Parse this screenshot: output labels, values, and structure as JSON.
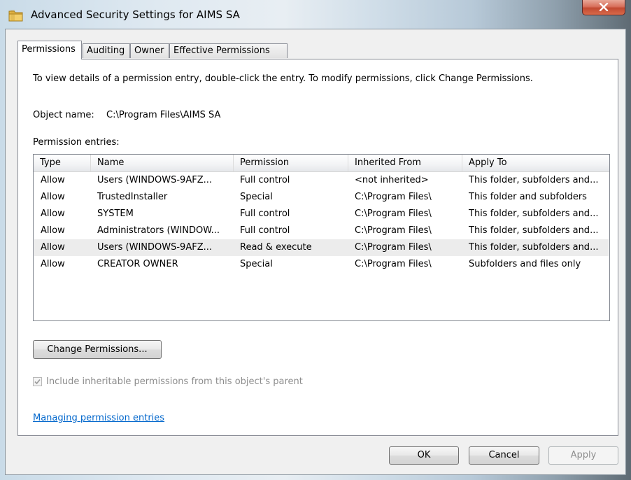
{
  "window": {
    "title": "Advanced Security Settings for AIMS SA"
  },
  "tabs": [
    {
      "label": "Permissions",
      "active": true
    },
    {
      "label": "Auditing",
      "active": false
    },
    {
      "label": "Owner",
      "active": false
    },
    {
      "label": "Effective Permissions",
      "active": false
    }
  ],
  "panel": {
    "instruction": "To view details of a permission entry, double-click the entry. To modify permissions, click Change Permissions.",
    "object_name_label": "Object name:",
    "object_name_value": "C:\\Program Files\\AIMS SA",
    "entries_label": "Permission entries:"
  },
  "table": {
    "columns": [
      "Type",
      "Name",
      "Permission",
      "Inherited From",
      "Apply To"
    ],
    "rows": [
      {
        "type": "Allow",
        "name": "Users (WINDOWS-9AFZ...",
        "permission": "Full control",
        "inherited_from": "<not inherited>",
        "apply_to": "This folder, subfolders and...",
        "selected": false
      },
      {
        "type": "Allow",
        "name": "TrustedInstaller",
        "permission": "Special",
        "inherited_from": "C:\\Program Files\\",
        "apply_to": "This folder and subfolders",
        "selected": false
      },
      {
        "type": "Allow",
        "name": "SYSTEM",
        "permission": "Full control",
        "inherited_from": "C:\\Program Files\\",
        "apply_to": "This folder, subfolders and...",
        "selected": false
      },
      {
        "type": "Allow",
        "name": "Administrators (WINDOW...",
        "permission": "Full control",
        "inherited_from": "C:\\Program Files\\",
        "apply_to": "This folder, subfolders and...",
        "selected": false
      },
      {
        "type": "Allow",
        "name": "Users (WINDOWS-9AFZ...",
        "permission": "Read & execute",
        "inherited_from": "C:\\Program Files\\",
        "apply_to": "This folder, subfolders and...",
        "selected": true
      },
      {
        "type": "Allow",
        "name": "CREATOR OWNER",
        "permission": "Special",
        "inherited_from": "C:\\Program Files\\",
        "apply_to": "Subfolders and files only",
        "selected": false
      }
    ]
  },
  "change_permissions_label": "Change Permissions...",
  "inherit_checkbox": {
    "label": "Include inheritable permissions from this object's parent",
    "checked": true,
    "disabled": true
  },
  "help_link": "Managing permission entries",
  "buttons": {
    "ok": "OK",
    "cancel": "Cancel",
    "apply": "Apply"
  },
  "icons": {
    "title": "folder-icon",
    "close": "close-icon",
    "checkbox": "checkmark-icon"
  },
  "colors": {
    "link": "#0066cc",
    "selected_row": "#ececec",
    "close_button": "#c24a32"
  }
}
